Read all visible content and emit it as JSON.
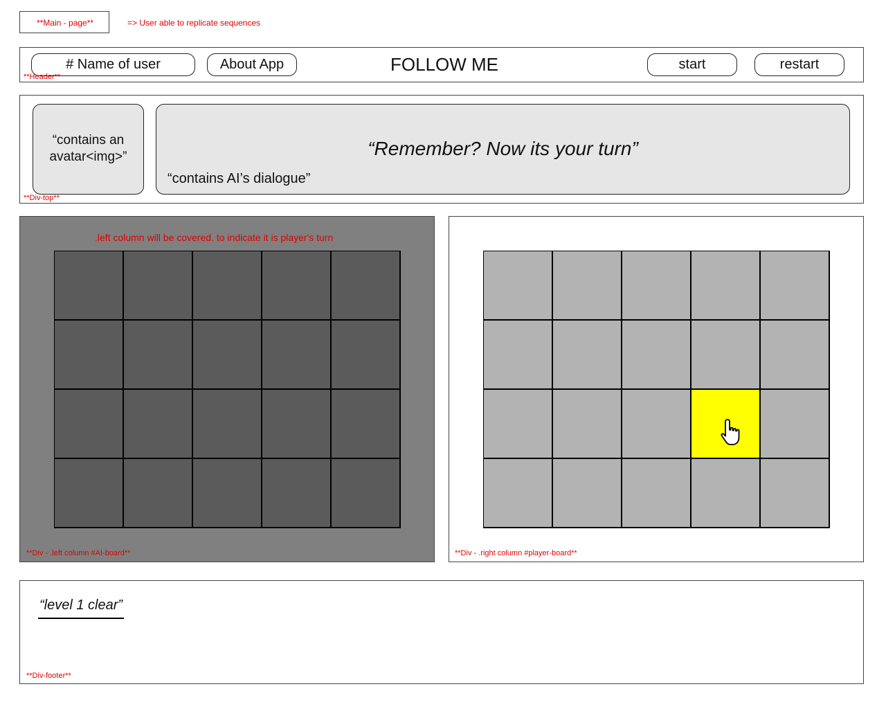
{
  "annotations": {
    "main_page": "**Main - page**",
    "main_page_note": "=> User able to replicate sequences",
    "header": "**Header**",
    "div_top": "**Div-top**",
    "left_column": "**Div - .left column #AI-board**",
    "right_column": "**Div - .right column #player-board**",
    "cover_note": ".left column will be covered. to indicate it is player's turn",
    "footer": "**Div-footer**"
  },
  "header": {
    "user_label": "# Name of user",
    "about_label": "About App",
    "app_title": "FOLLOW ME",
    "start_label": "start",
    "restart_label": "restart"
  },
  "top": {
    "avatar_text": "“contains an avatar<img>”",
    "dialogue_text": "“Remember? Now its your turn”",
    "dialogue_caption": "“contains AI’s dialogue”"
  },
  "boards": {
    "rows": 4,
    "cols": 5,
    "ai_cover_color": "#808080",
    "ai_cell_color": "#5b5b5b",
    "player_cell_color": "#b3b3b3",
    "highlight_color": "#ffff00",
    "highlighted_cell": {
      "row": 3,
      "col": 4
    },
    "cursor_icon": "hand-pointer-icon"
  },
  "footer": {
    "level_text": "“level 1 clear”"
  }
}
